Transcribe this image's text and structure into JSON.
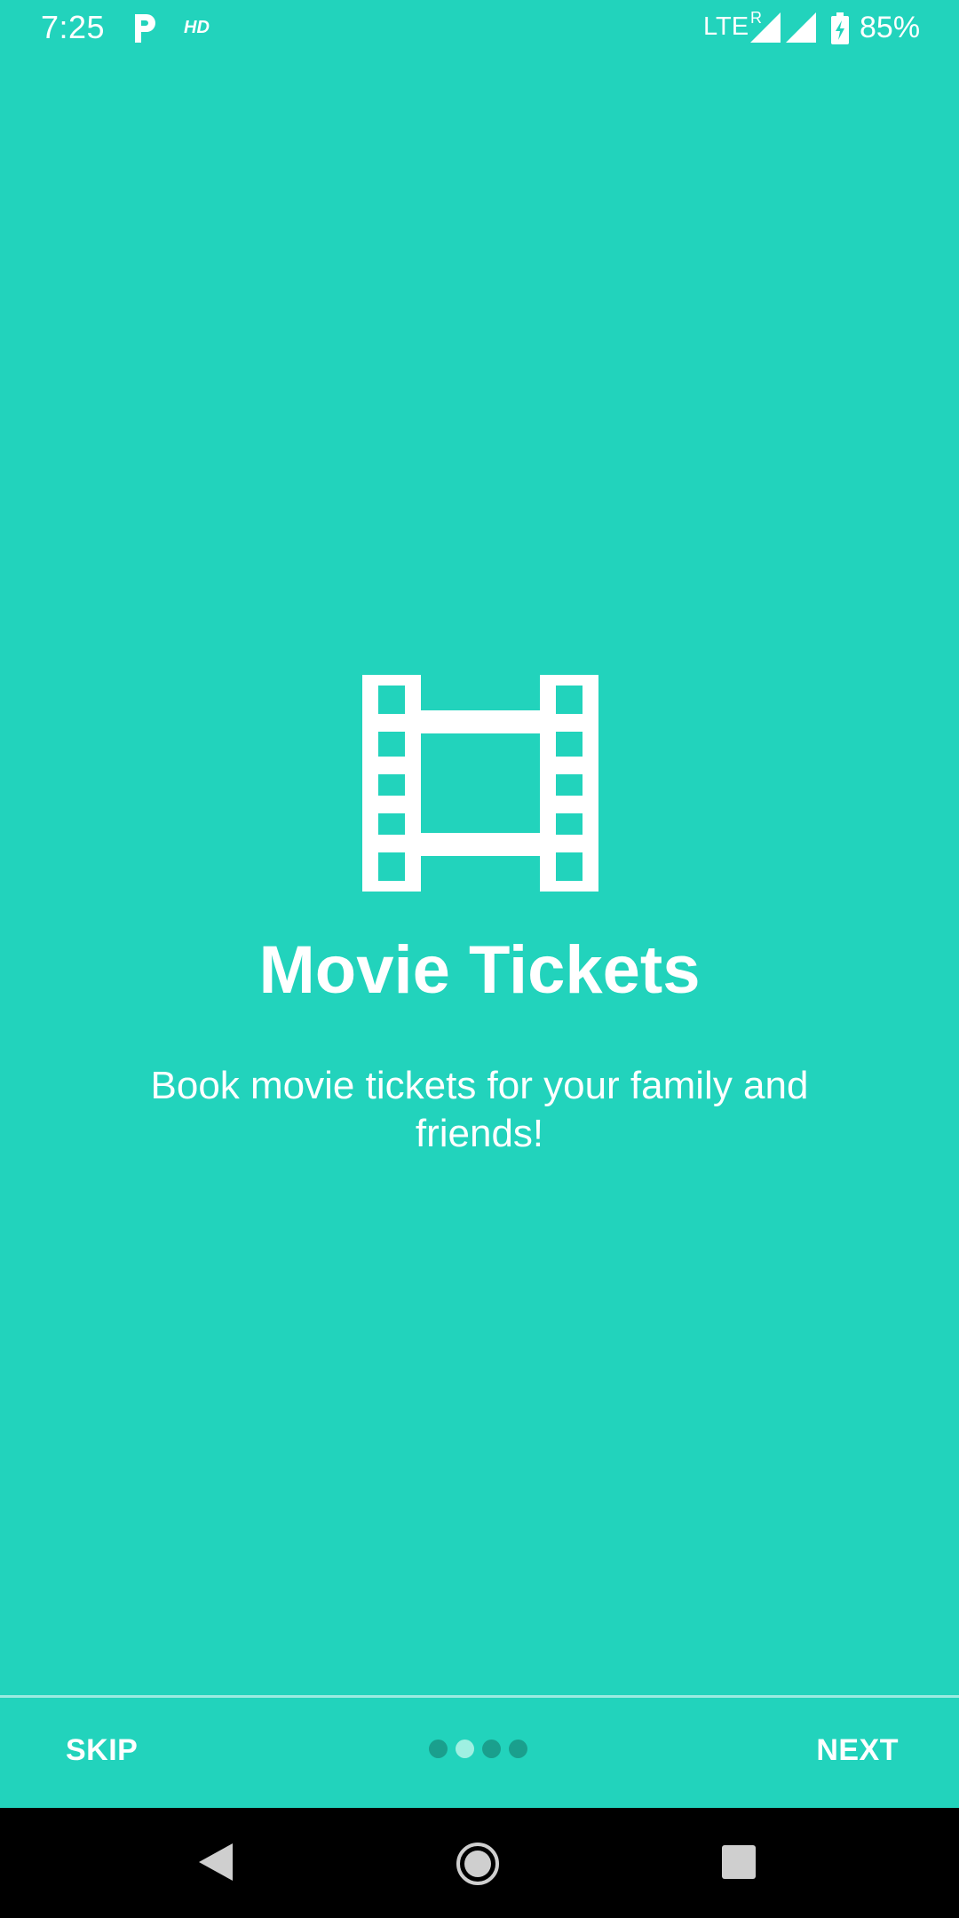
{
  "status_bar": {
    "time": "7:25",
    "hd_label": "HD",
    "network_label": "LTE",
    "roaming_label": "R",
    "battery_percent": "85%",
    "icons": [
      "parking-p-icon",
      "signal-icon",
      "signal-icon",
      "battery-charging-icon"
    ]
  },
  "onboarding": {
    "icon": "movie-film-icon",
    "title": "Movie Tickets",
    "description": "Book movie tickets for your family and friends!",
    "page_count": 4,
    "current_page": 2
  },
  "footer": {
    "skip_label": "SKIP",
    "next_label": "NEXT"
  },
  "nav_bar": {
    "icons": [
      "back-icon",
      "home-icon",
      "recents-icon"
    ]
  },
  "colors": {
    "background": "#22D3BC",
    "text": "#FFFFFF",
    "dot_inactive": "#1A9F8D",
    "dot_active": "#9FF0E2",
    "nav_bar": "#000000"
  }
}
